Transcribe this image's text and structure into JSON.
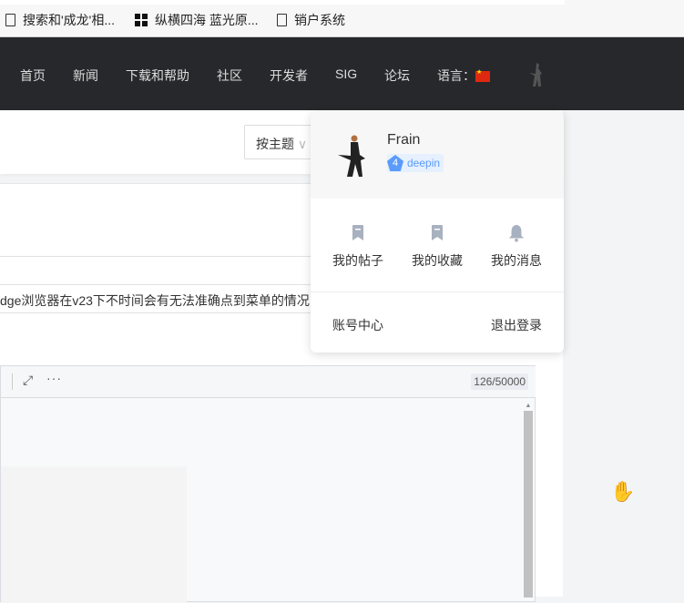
{
  "bookmarks": [
    {
      "icon": "file-icon",
      "label": "搜索和'成龙'相..."
    },
    {
      "icon": "grid-icon",
      "label": "纵横四海 蓝光原..."
    },
    {
      "icon": "file-icon",
      "label": "销户系统"
    }
  ],
  "nav": {
    "items": [
      "首页",
      "新闻",
      "下载和帮助",
      "社区",
      "开发者",
      "SIG",
      "论坛"
    ],
    "language_label": "语言："
  },
  "filter": {
    "selected": "按主题"
  },
  "post": {
    "title_value": "dge浏览器在v23下不时间会有无法准确点到菜单的情况"
  },
  "editor": {
    "counter": "126/50000"
  },
  "user_menu": {
    "username": "Frain",
    "level": "4",
    "badge": "deepin",
    "actions": [
      {
        "icon": "bookmark-icon",
        "label": "我的帖子"
      },
      {
        "icon": "bookmark-icon",
        "label": "我的收藏"
      },
      {
        "icon": "bell-icon",
        "label": "我的消息"
      }
    ],
    "account_center": "账号中心",
    "logout": "退出登录"
  }
}
